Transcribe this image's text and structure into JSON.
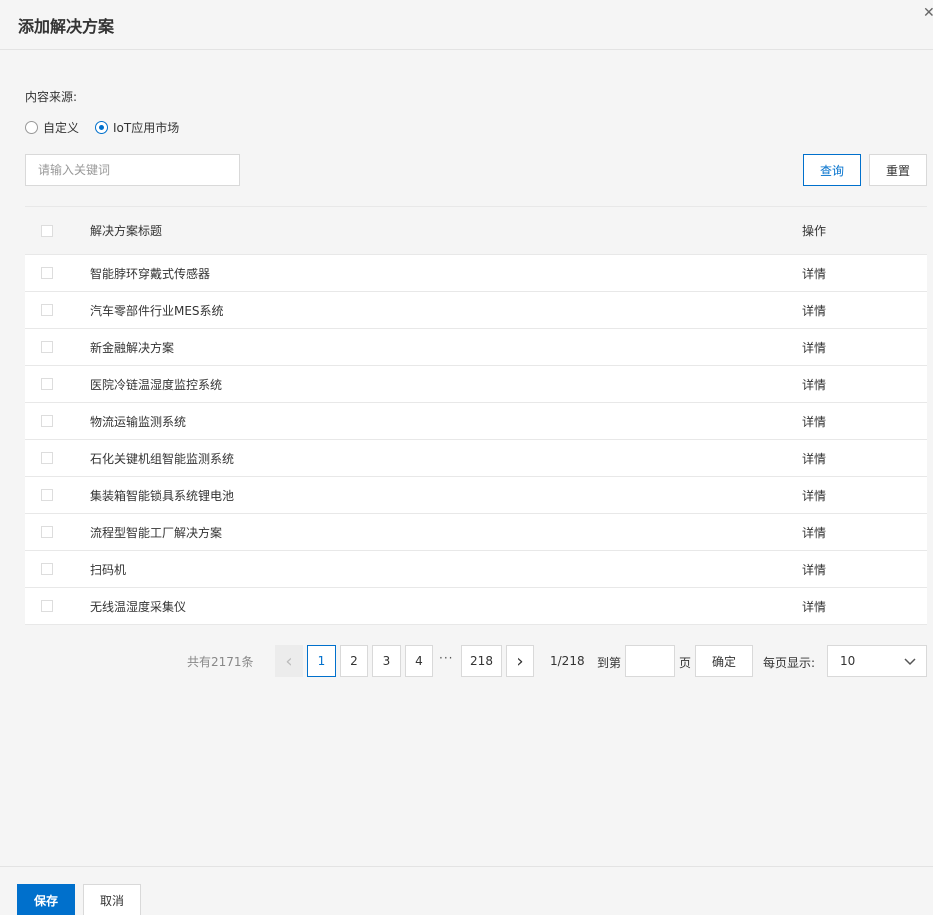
{
  "dialog": {
    "title": "添加解决方案",
    "close_glyph": "✕"
  },
  "form": {
    "source_label": "内容来源:",
    "options": [
      {
        "label": "自定义",
        "checked": false
      },
      {
        "label": "IoT应用市场",
        "checked": true
      }
    ],
    "search_placeholder": "请输入关键词",
    "query_label": "查询",
    "reset_label": "重置"
  },
  "table": {
    "headers": {
      "title": "解决方案标题",
      "op": "操作"
    },
    "rows": [
      {
        "title": "智能脖环穿戴式传感器",
        "op": "详情"
      },
      {
        "title": "汽车零部件行业MES系统",
        "op": "详情"
      },
      {
        "title": "新金融解决方案",
        "op": "详情"
      },
      {
        "title": "医院冷链温湿度监控系统",
        "op": "详情"
      },
      {
        "title": "物流运输监测系统",
        "op": "详情"
      },
      {
        "title": "石化关键机组智能监测系统",
        "op": "详情"
      },
      {
        "title": "集装箱智能锁具系统锂电池",
        "op": "详情"
      },
      {
        "title": "流程型智能工厂解决方案",
        "op": "详情"
      },
      {
        "title": "扫码机",
        "op": "详情"
      },
      {
        "title": "无线温湿度采集仪",
        "op": "详情"
      }
    ]
  },
  "pagination": {
    "total_text": "共有2171条",
    "prev_glyph": "‹",
    "next_glyph": "›",
    "pages": [
      "1",
      "2",
      "3",
      "4"
    ],
    "ellipsis": "···",
    "last_page": "218",
    "page_info": "1/218",
    "goto_label": "到第",
    "page_unit": "页",
    "confirm_label": "确定",
    "per_page_label": "每页显示:",
    "per_page_value": "10"
  },
  "accent_color": "#0070cc",
  "footer": {
    "save_label": "保存",
    "cancel_label": "取消"
  }
}
